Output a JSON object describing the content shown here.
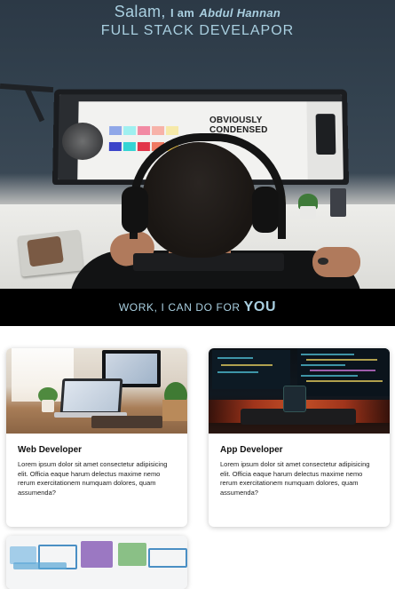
{
  "hero": {
    "greeting": "Salam,",
    "i_am": "I am",
    "name": "Abdul Hannan",
    "subtitle": "FULL STACK DEVELAPOR",
    "screen_text_1": "OBVIOUSLY",
    "screen_text_2": "CONDENSED"
  },
  "banner": {
    "prefix": "WORK, I CAN DO FOR",
    "emphasis": "YOU"
  },
  "cards": [
    {
      "title": "Web Developer",
      "text": "Lorem ipsum dolor sit amet consectetur adipisicing elit. Officia eaque harum delectus maxime nemo rerum exercitationem numquam dolores, quam assumenda?"
    },
    {
      "title": "App Developer",
      "text": "Lorem ipsum dolor sit amet consectetur adipisicing elit. Officia eaque harum delectus maxime nemo rerum exercitationem numquam dolores, quam assumenda?"
    }
  ],
  "colors": {
    "accent_text": "#a9cfe0",
    "banner_bg": "#000000",
    "card_bg": "#ffffff"
  }
}
